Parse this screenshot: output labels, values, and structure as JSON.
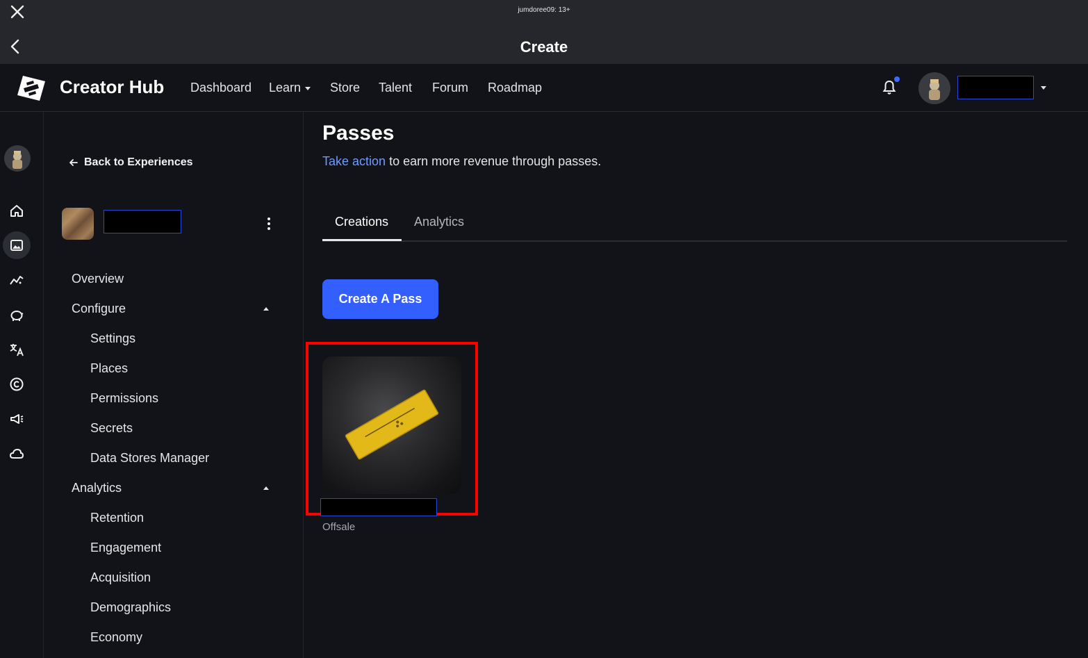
{
  "top_bar": {
    "title": "jumdoree09: 13+"
  },
  "sub_bar": {
    "title": "Create"
  },
  "nav": {
    "brand": "Creator Hub",
    "links": [
      "Dashboard",
      "Learn",
      "Store",
      "Talent",
      "Forum",
      "Roadmap"
    ],
    "notification_dot_color": "#3b6cff"
  },
  "rail": {
    "icons": [
      "home-icon",
      "images-icon",
      "analytics-icon",
      "piggy-bank-icon",
      "translate-icon",
      "copyright-icon",
      "megaphone-icon",
      "cloud-icon"
    ],
    "active": "images-icon"
  },
  "sidebar": {
    "back_label": "Back to Experiences",
    "items": {
      "overview": "Overview",
      "configure": "Configure",
      "settings": "Settings",
      "places": "Places",
      "permissions": "Permissions",
      "secrets": "Secrets",
      "data_stores": "Data Stores Manager",
      "analytics": "Analytics",
      "retention": "Retention",
      "engagement": "Engagement",
      "acquisition": "Acquisition",
      "demographics": "Demographics",
      "economy": "Economy"
    }
  },
  "main": {
    "title": "Passes",
    "subtitle_link": "Take action",
    "subtitle_rest": " to earn more revenue through passes.",
    "tabs": [
      "Creations",
      "Analytics"
    ],
    "active_tab": "Creations",
    "create_button": "Create A Pass",
    "accent_color": "#335fff",
    "pass": {
      "status": "Offsale",
      "highlight_color": "#ff0000"
    }
  }
}
